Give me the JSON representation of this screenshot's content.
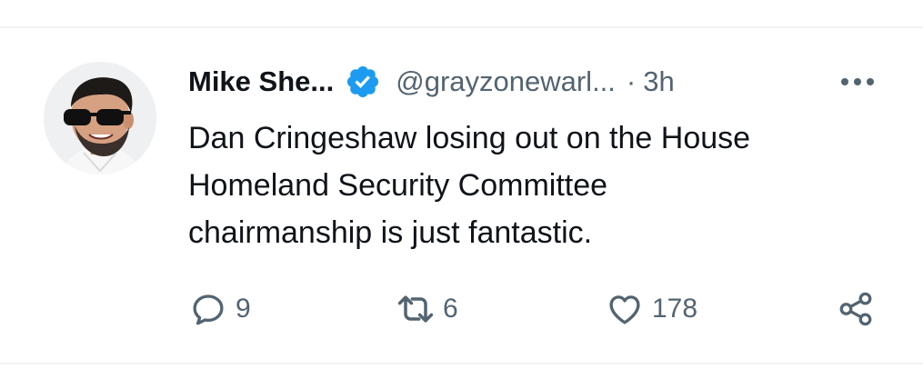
{
  "tweet": {
    "author_name": "Mike She...",
    "handle": "@grayzonewarl...",
    "separator": "·",
    "time": "3h",
    "text": "Dan Cringeshaw losing out on the House\nHomeland Security Committee\nchairmanship is just fantastic.",
    "verified": true
  },
  "actions": {
    "reply_icon": "reply-icon",
    "reply_count": "9",
    "retweet_icon": "retweet-icon",
    "retweet_count": "6",
    "like_icon": "heart-icon",
    "like_count": "178",
    "share_icon": "share-icon"
  },
  "icons": {
    "verified": "verified-badge-icon",
    "more": "more-dots-icon"
  },
  "colors": {
    "text_primary": "#0f1419",
    "text_secondary": "#536471",
    "verified_blue": "#1d9bf0",
    "divider": "#eff3f4"
  }
}
